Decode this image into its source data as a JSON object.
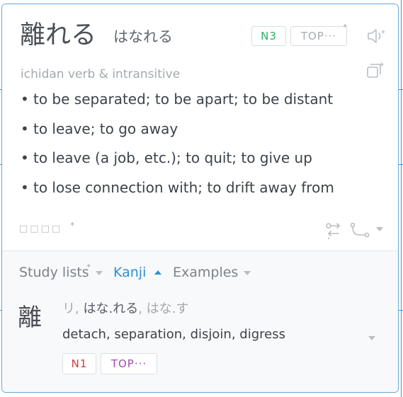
{
  "entry": {
    "headword": "離れる",
    "reading": "はなれる",
    "jlpt_tag": "N3",
    "frequency_tag": "TOP···",
    "part_of_speech": "ichidan verb & intransitive",
    "glosses": [
      "to be separated; to be apart; to be distant",
      "to leave; to go away",
      "to leave (a job, etc.); to quit; to give up",
      "to lose connection with; to drift away from"
    ],
    "placeholder_squares": "□□□□",
    "bullet": "•"
  },
  "footer": {
    "tabs": [
      {
        "label": "Study lists",
        "active": false
      },
      {
        "label": "Kanji",
        "active": true
      },
      {
        "label": "Examples",
        "active": false
      }
    ],
    "kanji": {
      "character": "離",
      "on_reading": "リ",
      "kun_reading_1": "はな.れる",
      "kun_reading_2": "はな.す",
      "separator": ",",
      "meaning": "detach, separation, disjoin, digress",
      "jlpt_tag": "N1",
      "frequency_tag": "TOP···"
    }
  },
  "colors": {
    "accent_blue": "#2f8fd2",
    "jlpt_n3_green": "#2bb063",
    "jlpt_n1_red": "#d03a3a",
    "frequency_purple": "#9b4fb0",
    "border_blue": "#6aa8d6"
  },
  "icons": {
    "speaker": "speaker-icon",
    "anki_add": "anki-add-icon",
    "convert": "convert-icon",
    "path": "path-icon",
    "sparkle": "sparkle-icon"
  }
}
